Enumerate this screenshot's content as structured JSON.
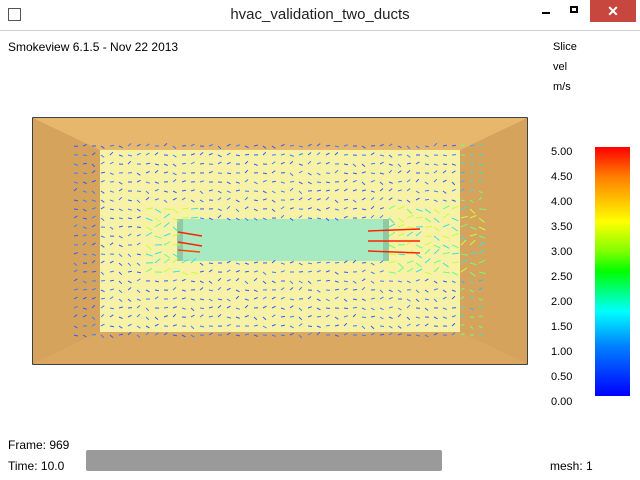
{
  "window": {
    "title": "hvac_validation_two_ducts",
    "minimize_icon": "minimize-icon",
    "maximize_icon": "maximize-icon",
    "close_icon": "close-icon",
    "close_glyph": "✕"
  },
  "viewer": {
    "version_label": "Smokeview 6.1.5 - Nov 22 2013",
    "slice_label": "Slice",
    "quantity_label": "vel",
    "unit_label": "m/s",
    "frame_label": "Frame: 969",
    "time_label": "Time: 10.0",
    "mesh_label": "mesh: 1"
  },
  "colorbar": {
    "ticks": [
      "5.00",
      "4.50",
      "4.00",
      "3.50",
      "3.00",
      "2.50",
      "2.00",
      "1.50",
      "1.00",
      "0.50",
      "0.00"
    ]
  },
  "colors": {
    "room_frame": "#e2b066",
    "floor": "#f8f2a6",
    "duct": "#a7e9c1",
    "close_button": "#c7463d"
  }
}
